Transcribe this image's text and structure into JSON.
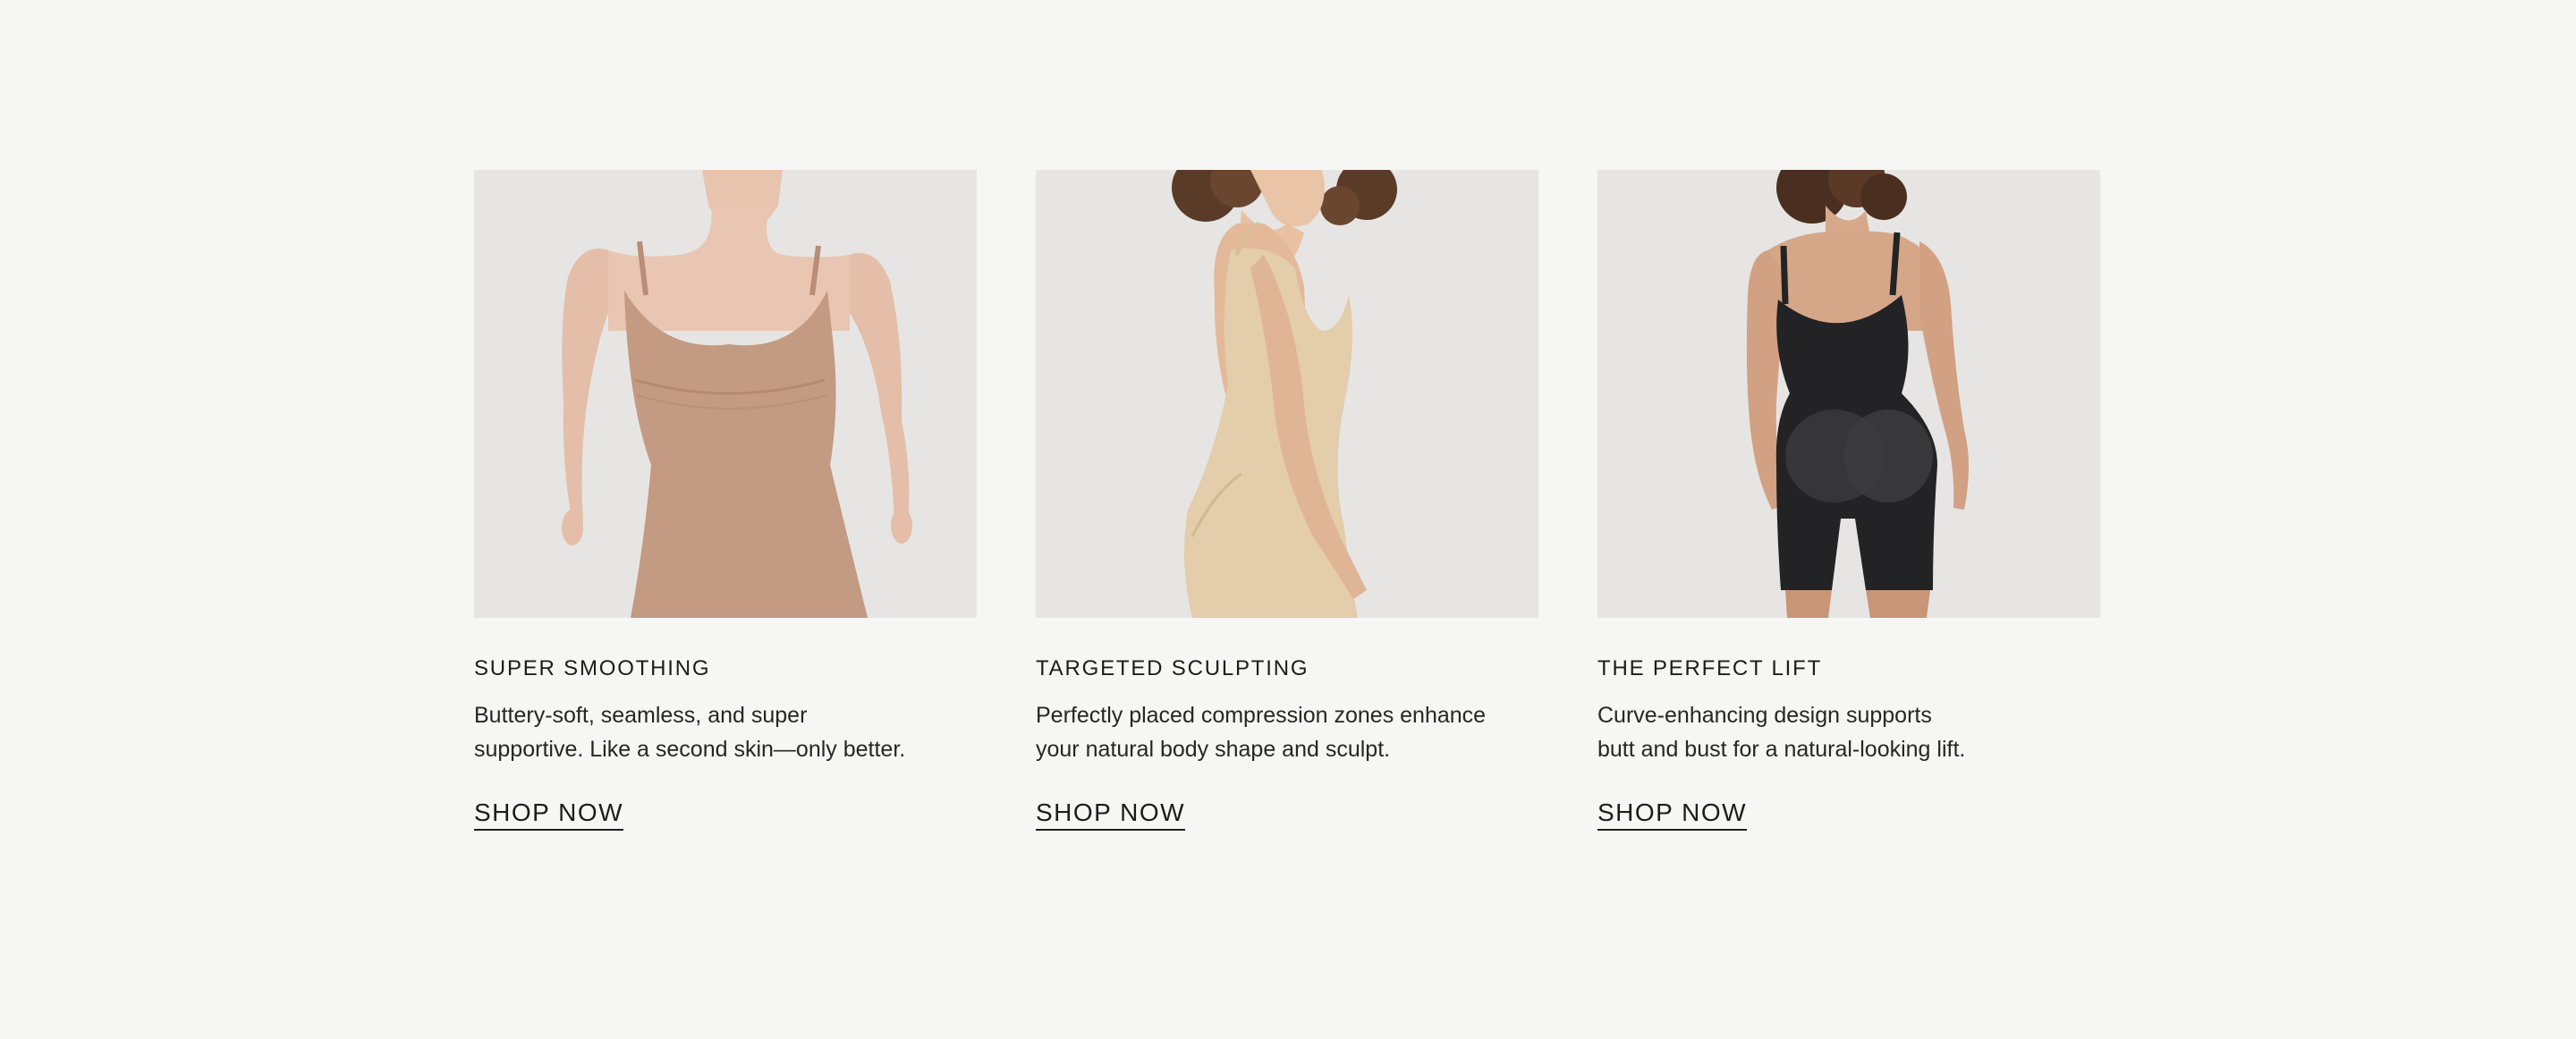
{
  "cards": [
    {
      "title": "SUPER SMOOTHING",
      "description": "Buttery-soft, seamless, and super\nsupportive. Like a second skin—only better.",
      "cta": "SHOP NOW",
      "garment_color": "#c39a82"
    },
    {
      "title": "TARGETED SCULPTING",
      "description": "Perfectly placed compression zones enhance\nyour natural body shape and sculpt.",
      "cta": "SHOP NOW",
      "garment_color": "#e3cdaa"
    },
    {
      "title": "THE PERFECT LIFT",
      "description": "Curve-enhancing design supports\nbutt and bust for a natural-looking lift.",
      "cta": "SHOP NOW",
      "garment_color": "#232325"
    }
  ]
}
